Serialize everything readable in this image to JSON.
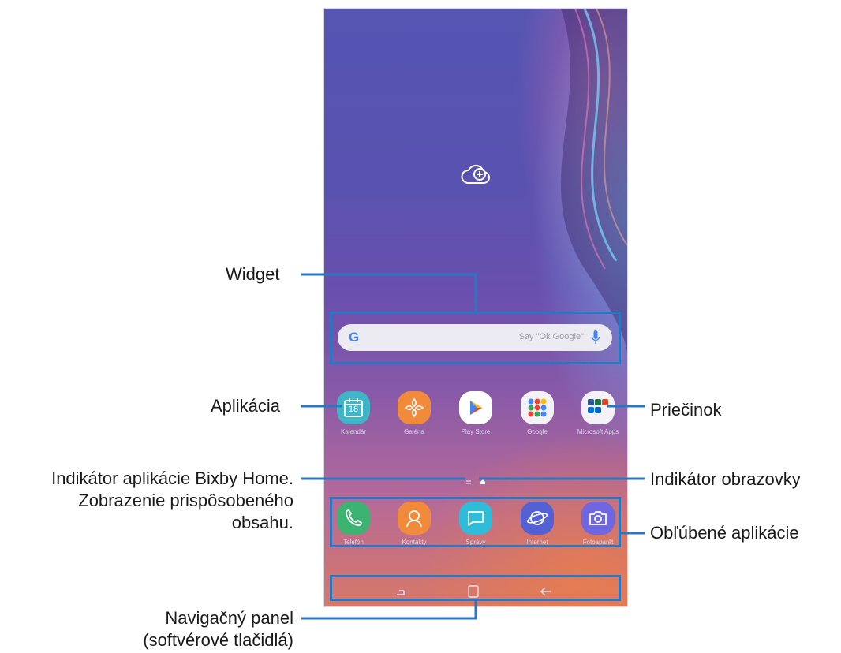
{
  "callouts": {
    "widget": "Widget",
    "apps": "Aplikácia",
    "bixby_line1": "Indikátor aplikácie Bixby Home.",
    "bixby_line2": "Zobrazenie prispôsobeného",
    "bixby_line3": "obsahu.",
    "folder": "Priečinok",
    "screen_indicator": "Indikátor obrazovky",
    "favorites": "Obľúbené aplikácie",
    "nav_line1": "Navigačný panel",
    "nav_line2": "(softvérové tlačidlá)"
  },
  "search": {
    "logo": "G",
    "hint": "Say \"Ok Google\""
  },
  "calendar_day": "18",
  "apps": [
    {
      "label": "Kalendár",
      "icon": "calendar-icon",
      "color": "#3fb5c8"
    },
    {
      "label": "Galéria",
      "icon": "gallery-icon",
      "color": "#f28a3b"
    },
    {
      "label": "Play Store",
      "icon": "play-store-icon",
      "color": "#ffffff"
    },
    {
      "label": "Google",
      "icon": "google-folder-icon",
      "color": "#f4f2f6"
    },
    {
      "label": "Microsoft Apps",
      "icon": "microsoft-folder-icon",
      "color": "#f4f2f6"
    }
  ],
  "dock": [
    {
      "label": "Telefón",
      "icon": "phone-icon",
      "color": "#3cb371"
    },
    {
      "label": "Kontakty",
      "icon": "contacts-icon",
      "color": "#f28a3b"
    },
    {
      "label": "Správy",
      "icon": "messages-icon",
      "color": "#2fbcd8"
    },
    {
      "label": "Internet",
      "icon": "internet-icon",
      "color": "#5461d4"
    },
    {
      "label": "Fotoaparát",
      "icon": "camera-icon",
      "color": "#6f67e0"
    }
  ],
  "colors": {
    "callout_blue": "#2a76c2"
  }
}
